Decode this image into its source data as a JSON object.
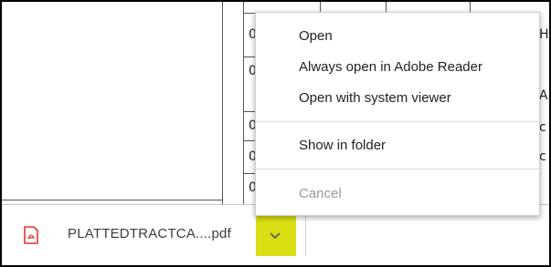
{
  "download_bar": {
    "file_name": "PLATTEDTRACTCA....pdf",
    "file_icon": "pdf-icon",
    "options_icon": "chevron-down-icon",
    "highlight_color": "#d9df13"
  },
  "context_menu": {
    "items": [
      {
        "label": "Open",
        "enabled": true
      },
      {
        "label": "Always open in Adobe Reader",
        "enabled": true
      },
      {
        "label": "Open with system viewer",
        "enabled": true
      },
      {
        "label": "Show in folder",
        "enabled": true
      },
      {
        "label": "Cancel",
        "enabled": false
      }
    ]
  },
  "background_table": {
    "fragments": [
      "0",
      "0",
      "0",
      "0",
      "0",
      "A",
      "c",
      "c",
      "H"
    ]
  }
}
